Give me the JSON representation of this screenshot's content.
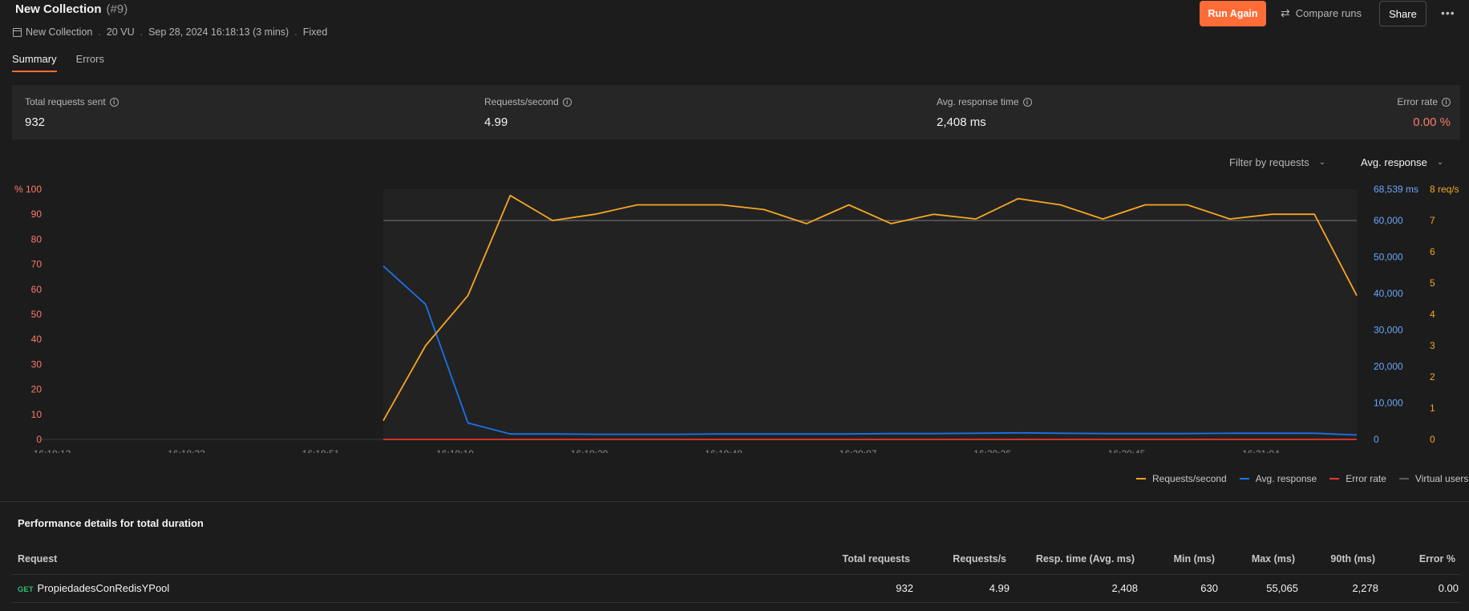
{
  "header": {
    "title": "New Collection",
    "run_number": "(#9)",
    "meta": [
      "New Collection",
      "20 VU",
      "Sep 28, 2024 16:18:13 (3 mins)",
      "Fixed"
    ],
    "meta_separator": ".",
    "run_again_label": "Run Again",
    "compare_label": "Compare runs",
    "share_label": "Share",
    "more_label": "•••"
  },
  "tabs": [
    {
      "label": "Summary",
      "active": true
    },
    {
      "label": "Errors",
      "active": false
    }
  ],
  "stats": [
    {
      "label": "Total requests sent",
      "value": "932",
      "color": "#f2f2f2"
    },
    {
      "label": "Requests/second",
      "value": "4.99",
      "color": "#f2f2f2"
    },
    {
      "label": "Avg. response time",
      "value": "2,408 ms",
      "color": "#f2f2f2"
    },
    {
      "label": "Error rate",
      "value": "0.00 %",
      "color": "#ff7a6b"
    }
  ],
  "filters": {
    "requests_label": "Filter by requests",
    "metric_label": "Avg. response"
  },
  "chart_data": {
    "type": "line",
    "x": [
      "16:18:13",
      "16:18:32",
      "16:18:51",
      "16:19:10",
      "16:19:29",
      "16:19:48",
      "16:20:07",
      "16:20:26",
      "16:20:45",
      "16:21:04"
    ],
    "y_left": {
      "unit_label": "%",
      "ticks": [
        "100",
        "90",
        "80",
        "70",
        "60",
        "50",
        "40",
        "30",
        "20",
        "10",
        "0"
      ],
      "color": "#ff7a6b"
    },
    "y_mid": {
      "ticks": [
        "68,539 ms",
        "60,000",
        "50,000",
        "40,000",
        "30,000",
        "20,000",
        "10,000",
        "0"
      ],
      "color": "#6aa6f8"
    },
    "y_right": {
      "ticks": [
        "8 req/s",
        "7",
        "6",
        "5",
        "4",
        "3",
        "2",
        "1",
        "0"
      ],
      "color": "#f5a623"
    },
    "series": [
      {
        "name": "Requests/second",
        "color": "#f5a623",
        "axis": "right",
        "values": [
          0.6,
          3.0,
          4.6,
          7.8,
          7.0,
          7.2,
          7.5,
          7.5,
          7.5,
          7.35,
          6.9,
          7.5,
          6.9,
          7.2,
          7.05,
          7.7,
          7.5,
          7.05,
          7.5,
          7.5,
          7.05,
          7.2,
          7.2,
          4.6
        ]
      },
      {
        "name": "Avg. response",
        "color": "#1a73e8",
        "axis": "mid",
        "values": [
          47500,
          37000,
          4500,
          1500,
          1500,
          1400,
          1400,
          1400,
          1500,
          1500,
          1500,
          1500,
          1600,
          1600,
          1700,
          1800,
          1700,
          1600,
          1600,
          1600,
          1700,
          1700,
          1700,
          1200
        ]
      },
      {
        "name": "Error rate",
        "color": "#e5382d",
        "axis": "left",
        "values": [
          0,
          0,
          0,
          0,
          0,
          0,
          0,
          0,
          0,
          0,
          0,
          0,
          0,
          0,
          0,
          0,
          0,
          0,
          0,
          0,
          0,
          0,
          0,
          0
        ]
      },
      {
        "name": "Virtual users",
        "color": "#5c5c5c",
        "axis": "right",
        "values": [
          7,
          7,
          7,
          7,
          7,
          7,
          7,
          7,
          7,
          7,
          7,
          7,
          7,
          7,
          7,
          7,
          7,
          7,
          7,
          7,
          7,
          7,
          7,
          7
        ]
      }
    ],
    "legend_position": "bottom-right"
  },
  "perf": {
    "title": "Performance details for total duration",
    "columns": [
      "Request",
      "Total requests",
      "Requests/s",
      "Resp. time (Avg. ms)",
      "Min (ms)",
      "Max (ms)",
      "90th (ms)",
      "Error %"
    ],
    "rows": [
      {
        "method": "GET",
        "name": "PropiedadesConRedisYPool",
        "total": "932",
        "rps": "4.99",
        "avg": "2,408",
        "min": "630",
        "max": "55,065",
        "p90": "2,278",
        "err": "0.00"
      }
    ]
  }
}
